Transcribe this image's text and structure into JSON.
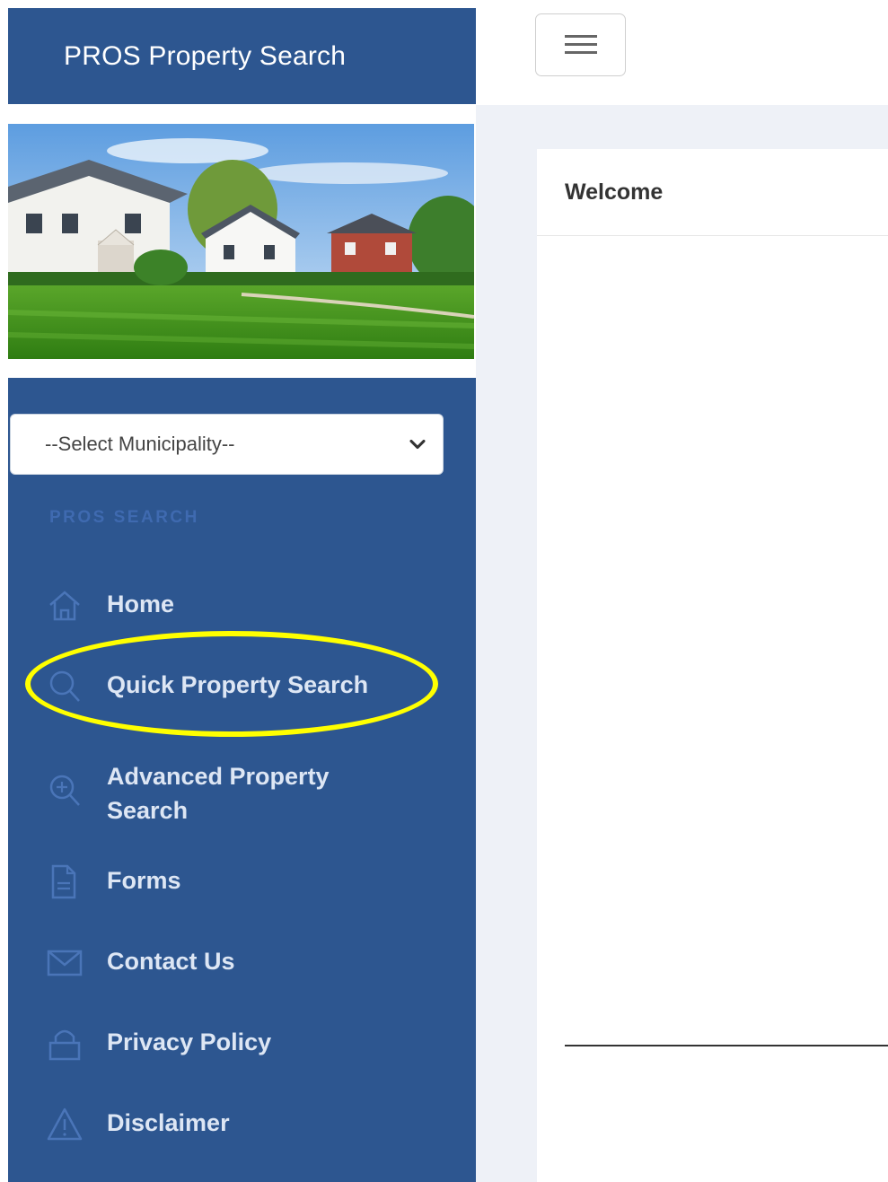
{
  "sidebar": {
    "brand": "PROS Property Search",
    "municipality_select": {
      "value": "--Select Municipality--"
    },
    "section_label": "PROS SEARCH",
    "items": [
      {
        "label": "Home",
        "icon": "home-icon"
      },
      {
        "label": "Quick Property Search",
        "icon": "search-icon"
      },
      {
        "label": "Advanced Property Search",
        "icon": "zoom-in-icon"
      },
      {
        "label": "Forms",
        "icon": "document-icon"
      },
      {
        "label": "Contact Us",
        "icon": "envelope-icon"
      },
      {
        "label": "Privacy Policy",
        "icon": "lock-icon"
      },
      {
        "label": "Disclaimer",
        "icon": "warning-icon"
      }
    ]
  },
  "topbar": {
    "menu_icon": "hamburger-icon"
  },
  "main": {
    "card_title": "Welcome"
  },
  "colors": {
    "sidebar_bg": "#2d5690",
    "highlight": "#ffff00",
    "content_bg": "#eef1f7"
  }
}
